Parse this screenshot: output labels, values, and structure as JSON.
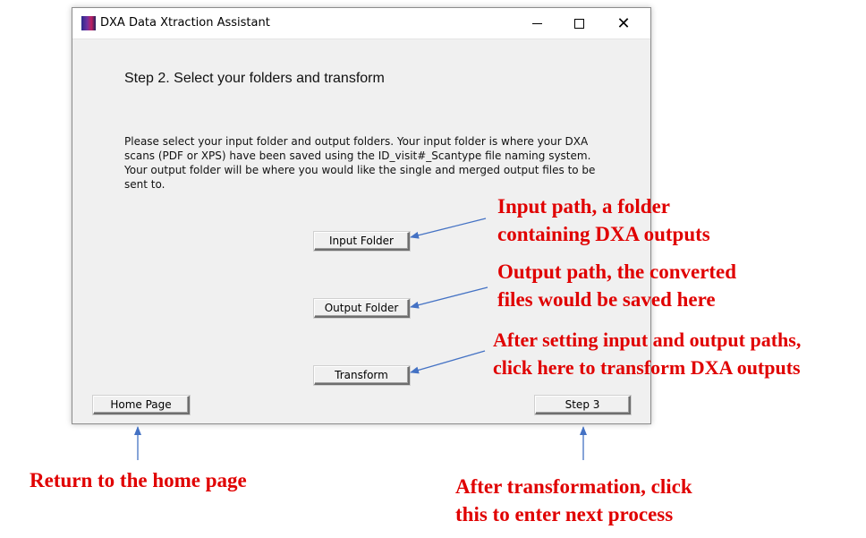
{
  "window": {
    "title": "DXA Data Xtraction Assistant",
    "controls": {
      "minimize": "",
      "maximize": "",
      "close": "✕"
    }
  },
  "main": {
    "heading": "Step 2. Select your folders and transform",
    "description": "Please select your input folder and output folders. Your input folder is where your DXA scans (PDF or XPS) have been saved using the ID_visit#_Scantype file naming system. Your output folder will be where you would like the single and merged output files to be sent to.",
    "buttons": {
      "input_folder": "Input Folder",
      "output_folder": "Output Folder",
      "transform": "Transform",
      "home_page": "Home Page",
      "step3": "Step 3"
    }
  },
  "annotations": {
    "input": [
      "Input path, a folder",
      "containing DXA outputs"
    ],
    "output": [
      "Output path, the converted",
      "files would be saved here"
    ],
    "transform": [
      "After setting input and output paths,",
      "click here to transform DXA outputs"
    ],
    "home": "Return to the home page",
    "step3": [
      "After transformation, click",
      "this to enter next process"
    ]
  },
  "colors": {
    "annotation": "#e00000",
    "arrow": "#4472c4",
    "window_bg": "#f0f0f0"
  }
}
